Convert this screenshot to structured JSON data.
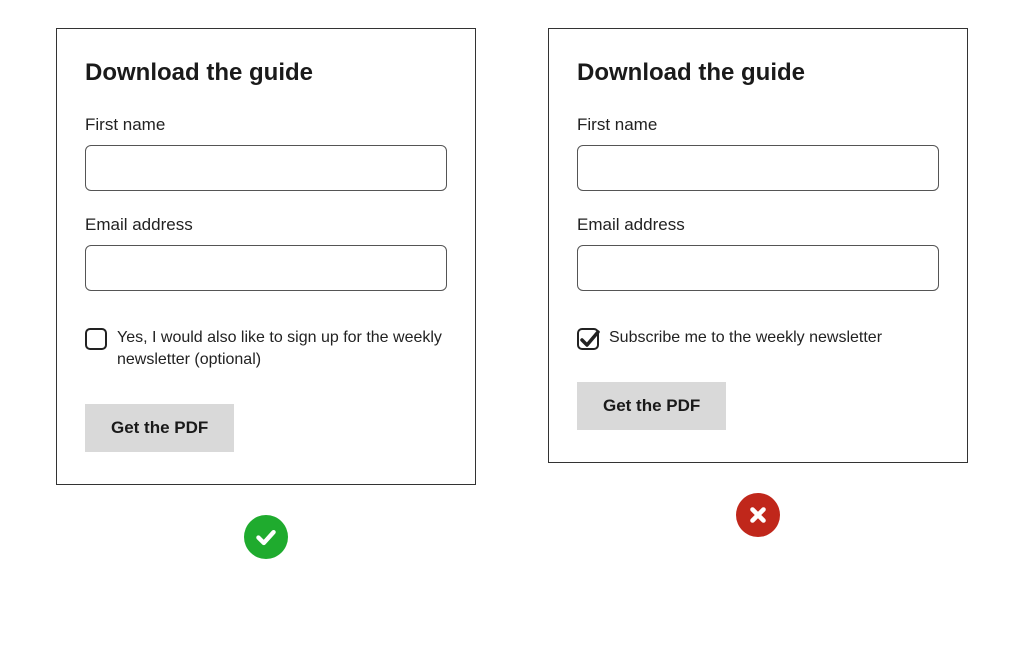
{
  "left": {
    "title": "Download the guide",
    "field1_label": "First name",
    "field1_value": "",
    "field2_label": "Email address",
    "field2_value": "",
    "checkbox_checked": false,
    "checkbox_label": "Yes, I would also like to sign up for the weekly newsletter (optional)",
    "button_label": "Get the PDF",
    "status": "good"
  },
  "right": {
    "title": "Download the guide",
    "field1_label": "First name",
    "field1_value": "",
    "field2_label": "Email address",
    "field2_value": "",
    "checkbox_checked": true,
    "checkbox_label": "Subscribe me to the weekly newsletter",
    "button_label": "Get the PDF",
    "status": "bad"
  },
  "colors": {
    "good": "#1fab2e",
    "bad": "#c0271b"
  }
}
